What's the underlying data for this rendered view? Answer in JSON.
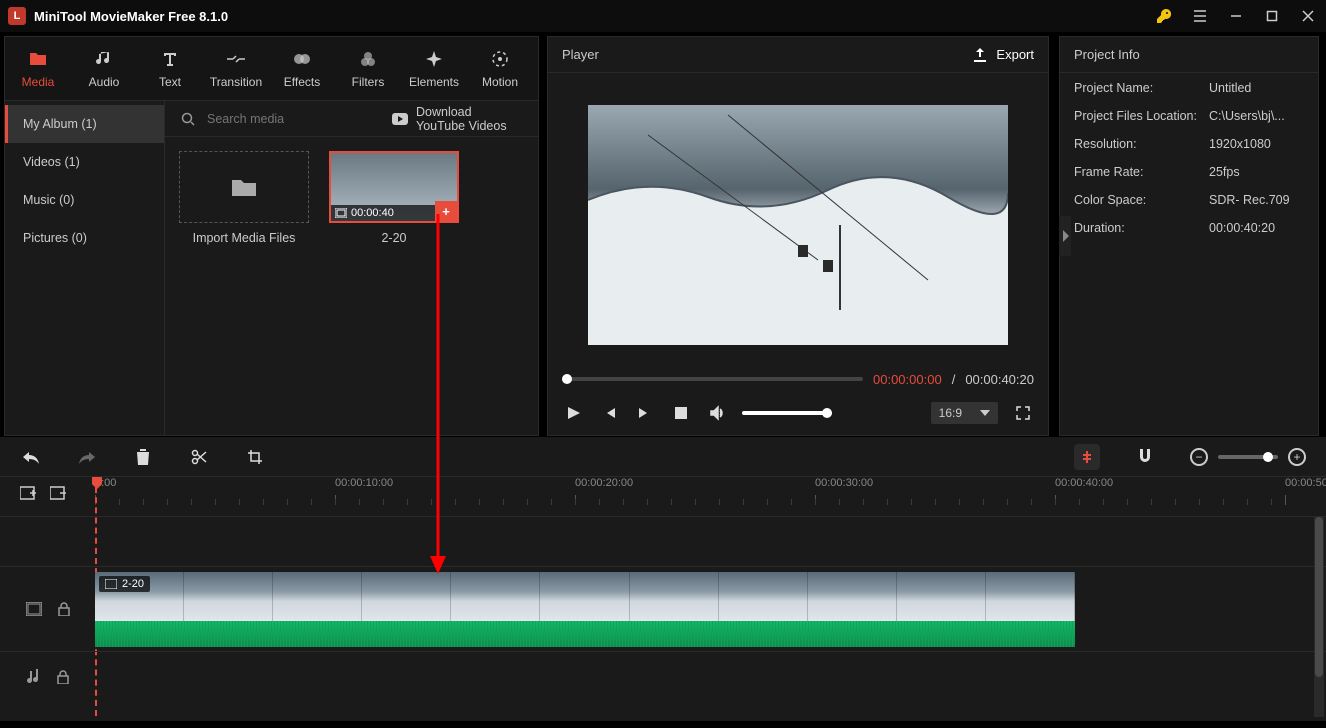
{
  "app": {
    "title": "MiniTool MovieMaker Free 8.1.0"
  },
  "toptabs": {
    "media": "Media",
    "audio": "Audio",
    "text": "Text",
    "transition": "Transition",
    "effects": "Effects",
    "filters": "Filters",
    "elements": "Elements",
    "motion": "Motion"
  },
  "mediaSidebar": {
    "myalbum": "My Album (1)",
    "videos": "Videos (1)",
    "music": "Music (0)",
    "pictures": "Pictures (0)"
  },
  "mediaTop": {
    "search_placeholder": "Search media",
    "download_yt": "Download YouTube Videos"
  },
  "thumbs": {
    "import_label": "Import Media Files",
    "clip_label": "2-20",
    "clip_duration": "00:00:40"
  },
  "player": {
    "title": "Player",
    "export": "Export",
    "time_current": "00:00:00:00",
    "time_total": "00:00:40:20",
    "aspect": "16:9"
  },
  "project": {
    "title": "Project Info",
    "name_k": "Project Name:",
    "name_v": "Untitled",
    "loc_k": "Project Files Location:",
    "loc_v": "C:\\Users\\bj\\...",
    "res_k": "Resolution:",
    "res_v": "1920x1080",
    "fps_k": "Frame Rate:",
    "fps_v": "25fps",
    "cs_k": "Color Space:",
    "cs_v": "SDR- Rec.709",
    "dur_k": "Duration:",
    "dur_v": "00:00:40:20"
  },
  "ruler": {
    "t0": "0:00",
    "t1": "00:00:10:00",
    "t2": "00:00:20:00",
    "t3": "00:00:30:00",
    "t4": "00:00:40:00",
    "t5": "00:00:50"
  },
  "clip": {
    "label": "2-20"
  }
}
